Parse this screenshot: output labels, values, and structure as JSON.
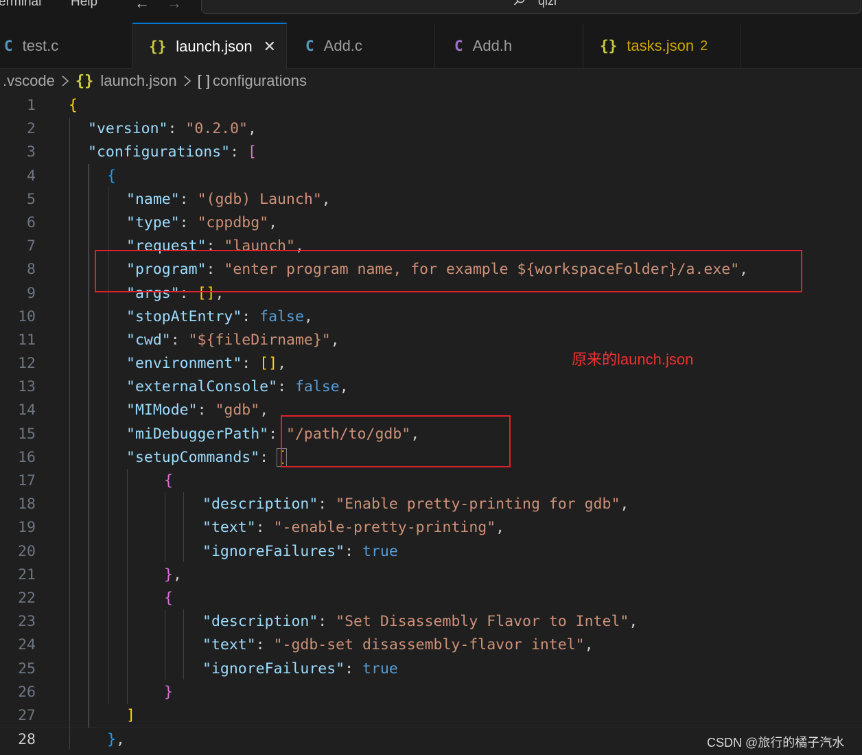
{
  "titlebar": {
    "menu": [
      "erminal",
      "Help"
    ],
    "back_arrow": "←",
    "forward_arrow": "→",
    "search_text": "qizi"
  },
  "tabs": [
    {
      "label": "test.c",
      "icon": "C"
    },
    {
      "label": "launch.json",
      "icon": "{}",
      "close": "✕"
    },
    {
      "label": "Add.c",
      "icon": "C"
    },
    {
      "label": "Add.h",
      "icon": "C"
    },
    {
      "label": "tasks.json",
      "icon": "{}",
      "badge": "2"
    }
  ],
  "breadcrumb": [
    ".vscode",
    "{}",
    "launch.json",
    "[ ]",
    "configurations"
  ],
  "line_numbers": [
    "1",
    "2",
    "3",
    "4",
    "5",
    "6",
    "7",
    "8",
    "9",
    "10",
    "11",
    "12",
    "13",
    "14",
    "15",
    "16",
    "17",
    "18",
    "19",
    "20",
    "21",
    "22",
    "23",
    "24",
    "25",
    "26",
    "27",
    "28"
  ],
  "code": {
    "l2": {
      "key": "\"version\"",
      "val": "\"0.2.0\""
    },
    "l3": {
      "key": "\"configurations\""
    },
    "l5": {
      "key": "\"name\"",
      "val": "\"(gdb) Launch\""
    },
    "l6": {
      "key": "\"type\"",
      "val": "\"cppdbg\""
    },
    "l7": {
      "key": "\"request\"",
      "val": "\"launch\""
    },
    "l8": {
      "key": "\"program\"",
      "val": "\"enter program name, for example ${workspaceFolder}/a.exe\""
    },
    "l9": {
      "key": "\"args\""
    },
    "l10": {
      "key": "\"stopAtEntry\"",
      "val": "false"
    },
    "l11": {
      "key": "\"cwd\"",
      "val": "\"${fileDirname}\""
    },
    "l12": {
      "key": "\"environment\""
    },
    "l13": {
      "key": "\"externalConsole\"",
      "val": "false"
    },
    "l14": {
      "key": "\"MIMode\"",
      "val": "\"gdb\""
    },
    "l15": {
      "key": "\"miDebuggerPath\"",
      "val": "\"/path/to/gdb\""
    },
    "l16": {
      "key": "\"setupCommands\""
    },
    "l18": {
      "key": "\"description\"",
      "val": "\"Enable pretty-printing for gdb\""
    },
    "l19": {
      "key": "\"text\"",
      "val": "\"-enable-pretty-printing\""
    },
    "l20": {
      "key": "\"ignoreFailures\"",
      "val": "true"
    },
    "l23": {
      "key": "\"description\"",
      "val": "\"Set Disassembly Flavor to Intel\""
    },
    "l24": {
      "key": "\"text\"",
      "val": "\"-gdb-set disassembly-flavor intel\""
    },
    "l25": {
      "key": "\"ignoreFailures\"",
      "val": "true"
    }
  },
  "annotation": "原来的launch.json",
  "watermark": "CSDN @旅行的橘子汽水",
  "colors": {
    "annotation_red": "#e0202a",
    "accent": "#0078d4"
  }
}
